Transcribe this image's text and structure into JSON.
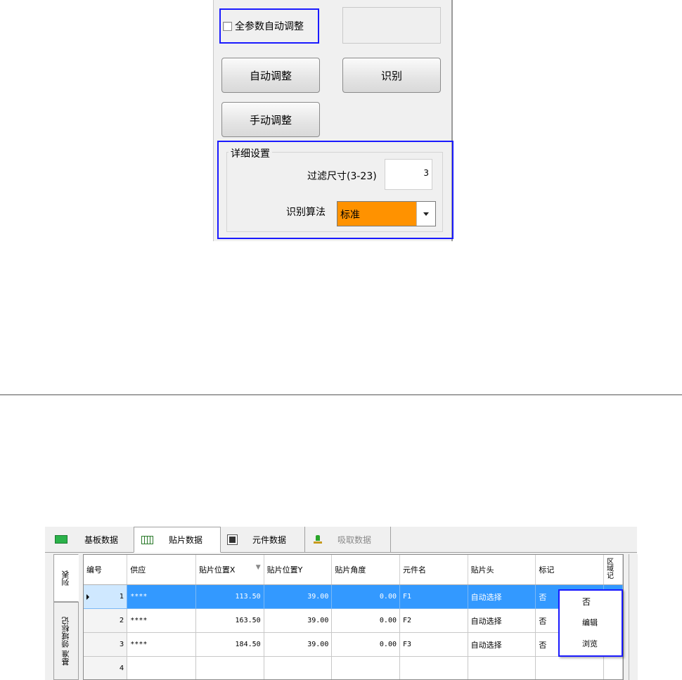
{
  "settings": {
    "all_params_checkbox_label": "全参数自动调整",
    "all_params_checked": false,
    "auto_adjust_button": "自动调整",
    "recognize_button": "识别",
    "manual_adjust_button": "手动调整",
    "detail_group_title": "详细设置",
    "filter_size_label": "过滤尺寸(3-23)",
    "filter_size_value": "3",
    "algorithm_label": "识别算法",
    "algorithm_value": "标准",
    "colors": {
      "highlight_border": "#1a1aff",
      "select_background": "#ff9200"
    }
  },
  "data_window": {
    "tabs": [
      {
        "label": "基板数据",
        "icon": "board-icon",
        "active": false,
        "enabled": true
      },
      {
        "label": "贴片数据",
        "icon": "grid-icon",
        "active": true,
        "enabled": true
      },
      {
        "label": "元件数据",
        "icon": "chip-icon",
        "active": false,
        "enabled": true
      },
      {
        "label": "吸取数据",
        "icon": "nozzle-icon",
        "active": false,
        "enabled": false
      }
    ],
    "side_tabs": [
      {
        "label": "列表",
        "active": true
      },
      {
        "label": "基准 领域标记",
        "active": false
      }
    ],
    "columns": [
      "编号",
      "供应",
      "贴片位置X",
      "贴片位置Y",
      "贴片角度",
      "元件名",
      "贴片头",
      "标记",
      "区域记"
    ],
    "sort_column": "贴片位置X",
    "rows": [
      {
        "no": "1",
        "feeder": "****",
        "x": "113.50",
        "y": "39.00",
        "angle": "0.00",
        "part": "F1",
        "head": "自动选择",
        "mark": "否",
        "selected": true
      },
      {
        "no": "2",
        "feeder": "****",
        "x": "163.50",
        "y": "39.00",
        "angle": "0.00",
        "part": "F2",
        "head": "自动选择",
        "mark": "否",
        "selected": false
      },
      {
        "no": "3",
        "feeder": "****",
        "x": "184.50",
        "y": "39.00",
        "angle": "0.00",
        "part": "F3",
        "head": "自动选择",
        "mark": "否",
        "selected": false
      },
      {
        "no": "4",
        "feeder": "",
        "x": "",
        "y": "",
        "angle": "",
        "part": "",
        "head": "",
        "mark": "",
        "selected": false
      }
    ],
    "context_menu": [
      "否",
      "编辑",
      "浏览"
    ],
    "colors": {
      "selected_row": "#3399ff"
    }
  }
}
